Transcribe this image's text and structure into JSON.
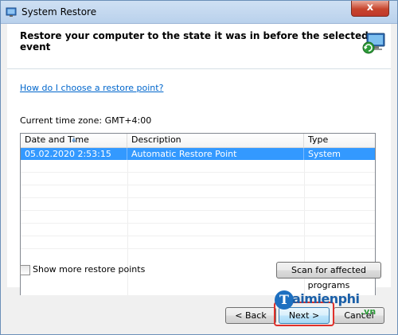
{
  "window": {
    "title": "System Restore",
    "close_label": "x"
  },
  "header": {
    "text": "Restore your computer to the state it was in before the selected event"
  },
  "content": {
    "help_link": "How do I choose a restore point?",
    "timezone": "Current time zone: GMT+4:00"
  },
  "table": {
    "columns": [
      "Date and Time",
      "Description",
      "Type"
    ],
    "rows": [
      {
        "date": "05.02.2020 2:53:15",
        "description": "Automatic Restore Point",
        "type": "System",
        "selected": true
      }
    ]
  },
  "options": {
    "show_more_label": "Show more restore points",
    "show_more_checked": false,
    "scan_label": "Scan for affected programs"
  },
  "footer": {
    "back_label": "< Back",
    "next_label": "Next >",
    "cancel_label": "Cancel"
  },
  "watermark": {
    "logo_letter": "T",
    "brand": "aimienphi",
    "sub": ".vn"
  },
  "colors": {
    "selection": "#3399ff",
    "link": "#0066cc",
    "highlight": "#e0302a"
  }
}
